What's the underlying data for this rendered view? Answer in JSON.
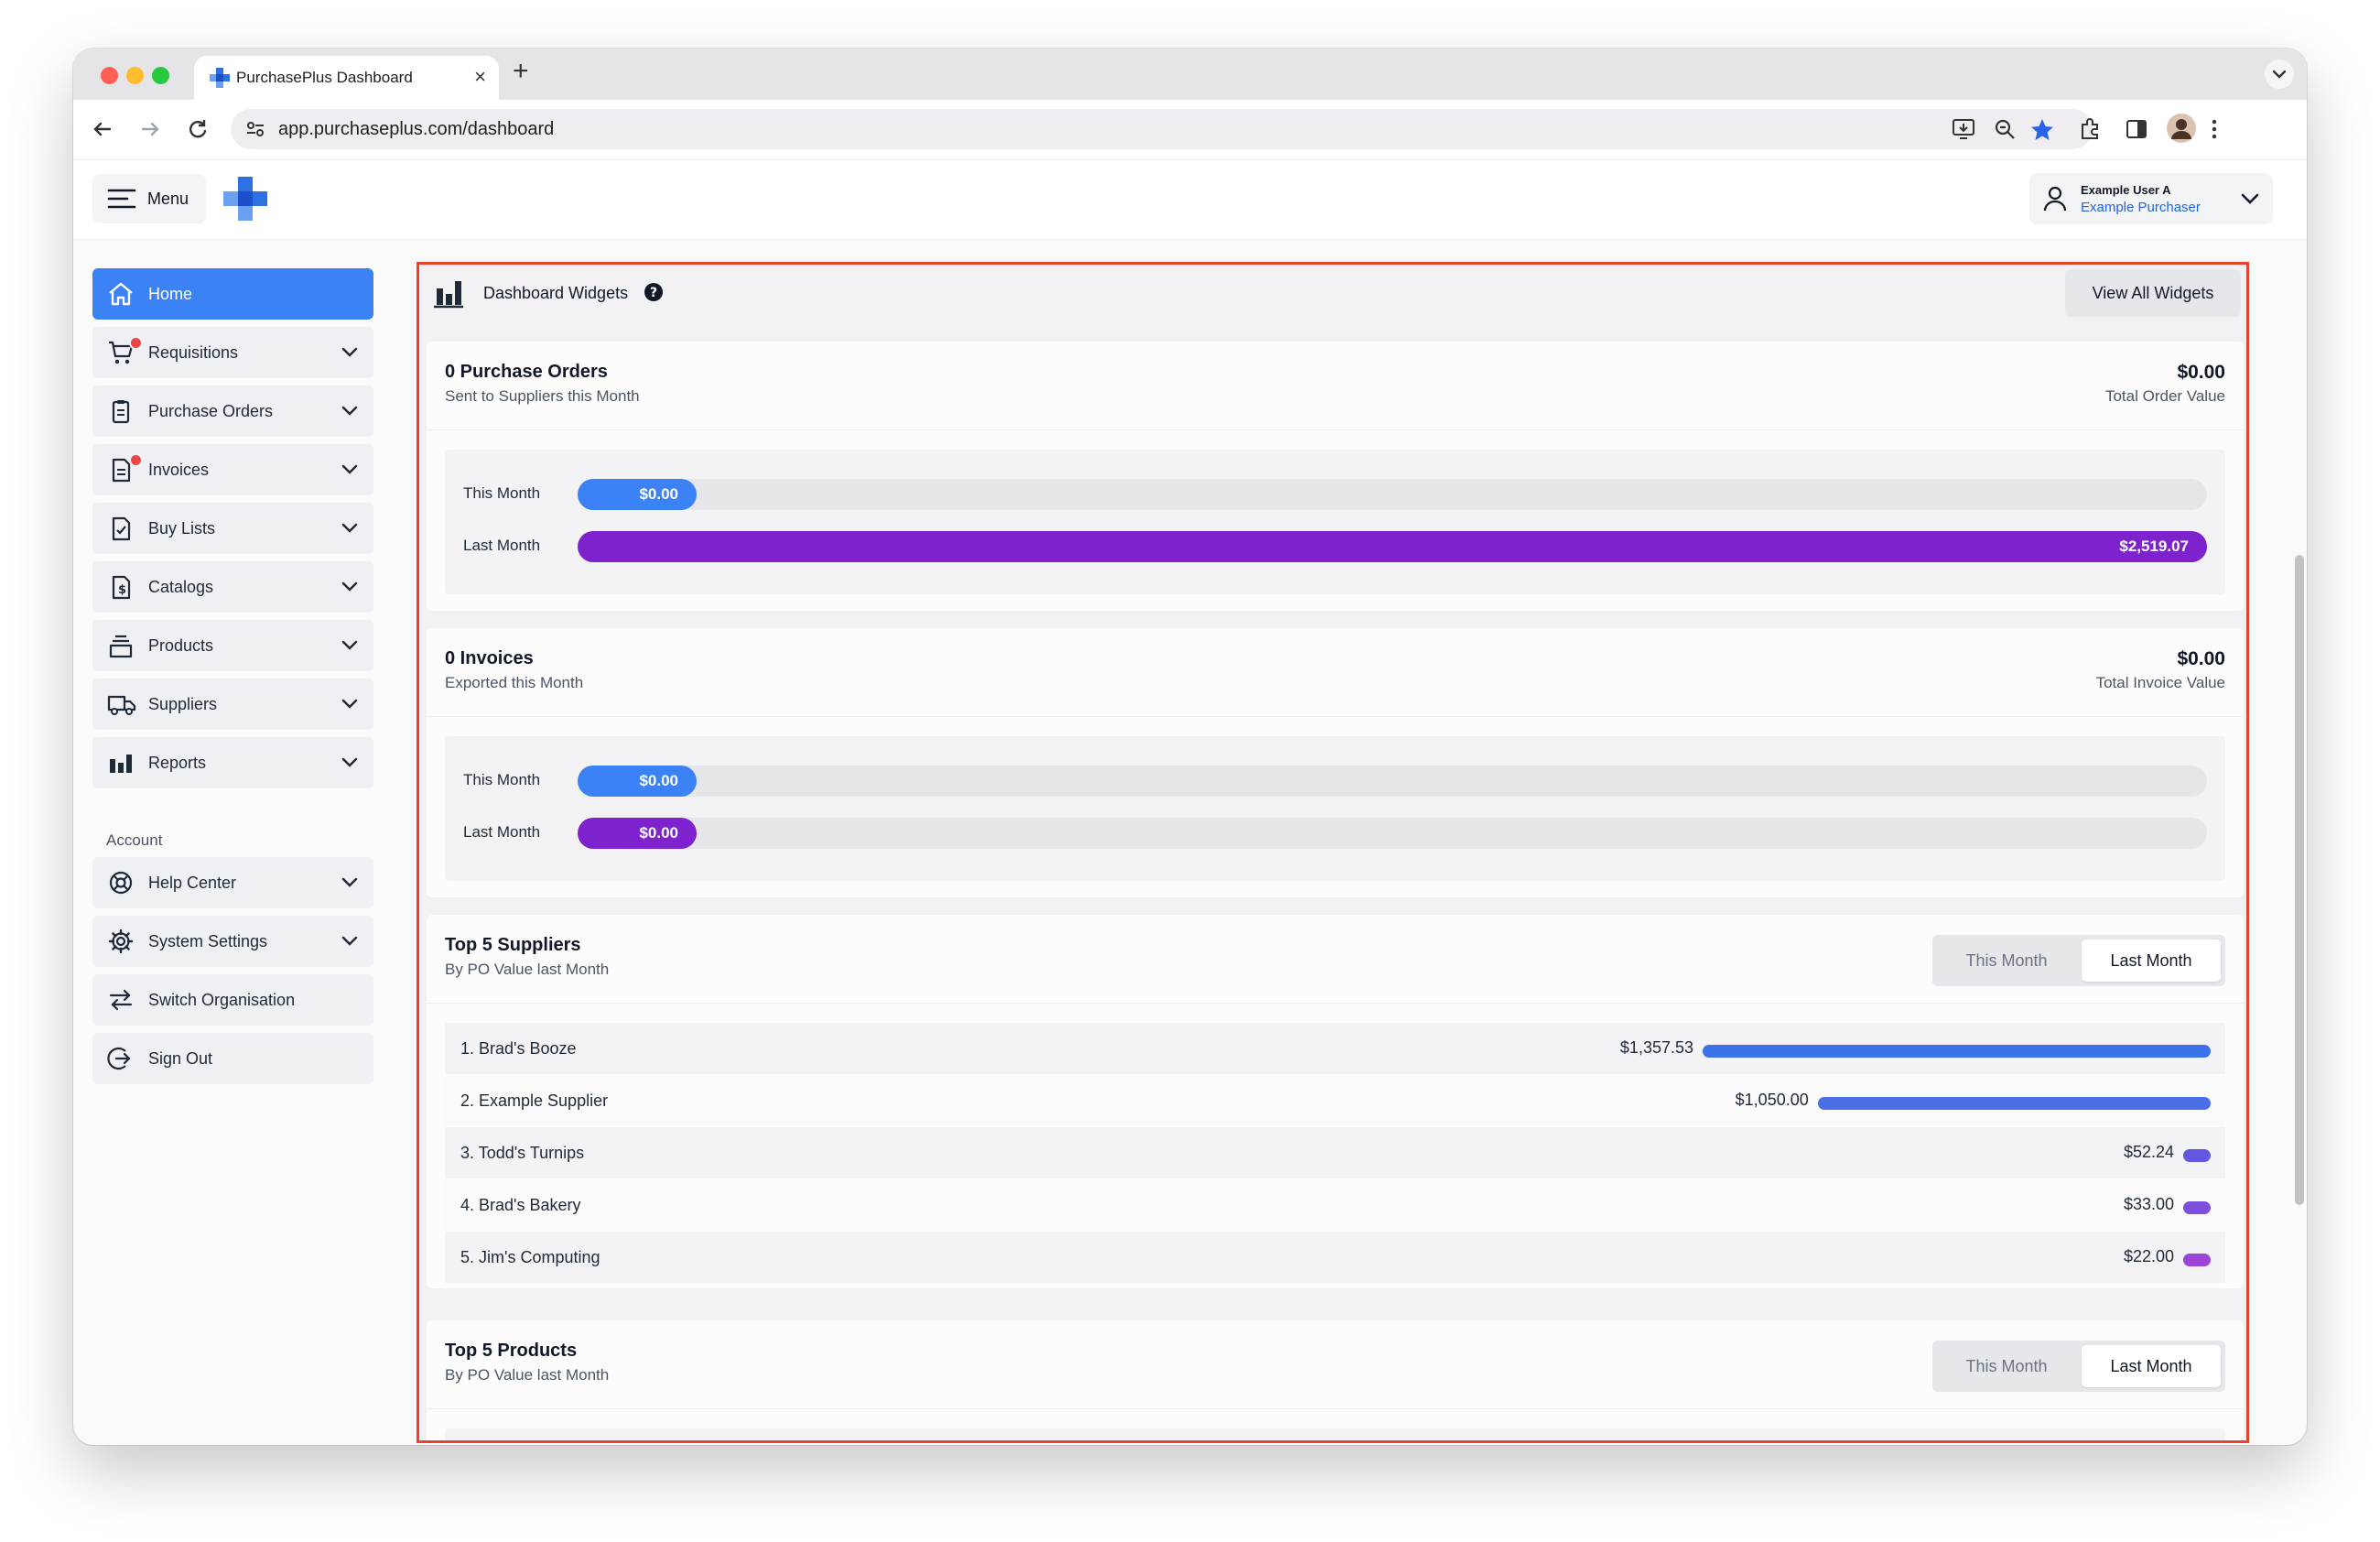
{
  "browser": {
    "tab_title": "PurchasePlus Dashboard",
    "url": "app.purchaseplus.com/dashboard"
  },
  "header": {
    "menu_label": "Menu",
    "user_name": "Example User A",
    "user_org": "Example Purchaser"
  },
  "sidebar": {
    "items": [
      {
        "label": "Home",
        "icon": "home-icon",
        "active": true
      },
      {
        "label": "Requisitions",
        "icon": "cart-icon"
      },
      {
        "label": "Purchase Orders",
        "icon": "clipboard-icon"
      },
      {
        "label": "Invoices",
        "icon": "invoice-icon"
      },
      {
        "label": "Buy Lists",
        "icon": "checklist-icon"
      },
      {
        "label": "Catalogs",
        "icon": "catalog-icon"
      },
      {
        "label": "Products",
        "icon": "products-icon"
      },
      {
        "label": "Suppliers",
        "icon": "truck-icon"
      },
      {
        "label": "Reports",
        "icon": "bar-chart-icon"
      }
    ],
    "account_label": "Account",
    "account_items": [
      {
        "label": "Help Center",
        "icon": "lifebuoy-icon"
      },
      {
        "label": "System Settings",
        "icon": "gear-icon"
      },
      {
        "label": "Switch Organisation",
        "icon": "switch-arrows-icon"
      },
      {
        "label": "Sign Out",
        "icon": "sign-out-icon"
      }
    ]
  },
  "widgets": {
    "title": "Dashboard Widgets",
    "view_all_label": "View All Widgets"
  },
  "purchase_orders": {
    "title": "0 Purchase Orders",
    "subtitle": "Sent to Suppliers this Month",
    "total": "$0.00",
    "total_label": "Total Order Value",
    "bars": [
      {
        "label": "This Month",
        "value_text": "$0.00",
        "fraction": 0.0,
        "color": "#3b82f6"
      },
      {
        "label": "Last Month",
        "value_text": "$2,519.07",
        "fraction": 1.0,
        "color": "#7e22ce"
      }
    ]
  },
  "invoices": {
    "title": "0 Invoices",
    "subtitle": "Exported this Month",
    "total": "$0.00",
    "total_label": "Total Invoice Value",
    "bars": [
      {
        "label": "This Month",
        "value_text": "$0.00",
        "fraction": 0.0,
        "color": "#3b82f6"
      },
      {
        "label": "Last Month",
        "value_text": "$0.00",
        "fraction": 0.0,
        "color": "#7e22ce"
      }
    ]
  },
  "top_suppliers": {
    "title": "Top 5 Suppliers",
    "subtitle": "By PO Value last Month",
    "toggle": [
      "This Month",
      "Last Month"
    ],
    "selected": "Last Month",
    "rows": [
      {
        "name": "1. Brad's Booze",
        "amount": "$1,357.53",
        "value": 1357.53,
        "color": "#3b74e8"
      },
      {
        "name": "2. Example Supplier",
        "amount": "$1,050.00",
        "value": 1050.0,
        "color": "#4a6ee6"
      },
      {
        "name": "3. Todd's Turnips",
        "amount": "$52.24",
        "value": 52.24,
        "color": "#6357e0"
      },
      {
        "name": "4. Brad's Bakery",
        "amount": "$33.00",
        "value": 33.0,
        "color": "#7d4ddb"
      },
      {
        "name": "5. Jim's Computing",
        "amount": "$22.00",
        "value": 22.0,
        "color": "#9b45d6"
      }
    ]
  },
  "top_products": {
    "title": "Top 5 Products",
    "subtitle": "By PO Value last Month",
    "toggle": [
      "This Month",
      "Last Month"
    ],
    "selected": "Last Month"
  }
}
